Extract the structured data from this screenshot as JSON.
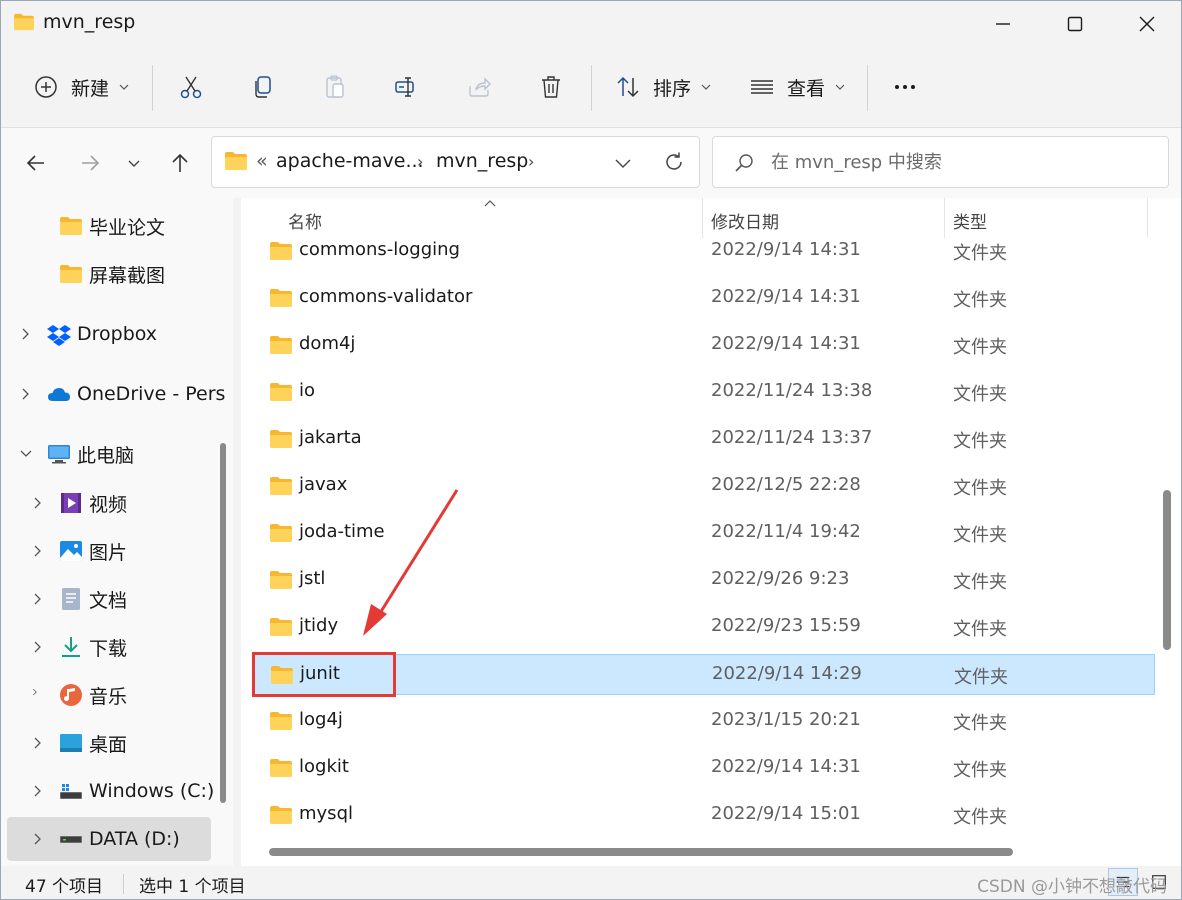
{
  "window": {
    "title": "mvn_resp",
    "minimize_icon": "minimize-icon",
    "maximize_icon": "maximize-icon",
    "close_icon": "close-icon"
  },
  "toolbar": {
    "new_label": "新建",
    "sort_label": "排序",
    "view_label": "查看",
    "icons": [
      "cut-icon",
      "copy-icon",
      "paste-icon",
      "rename-icon",
      "share-icon",
      "delete-icon",
      "more-icon"
    ]
  },
  "address_bar": {
    "overflow": "«",
    "segments": [
      "apache-mave...",
      "mvn_resp"
    ],
    "separator": "›"
  },
  "search": {
    "placeholder": "在 mvn_resp 中搜索"
  },
  "sidebar": {
    "items": [
      {
        "label": "毕业论文",
        "icon": "folder-icon",
        "expandable": false
      },
      {
        "label": "屏幕截图",
        "icon": "folder-icon",
        "expandable": false
      },
      {
        "label": "Dropbox",
        "icon": "dropbox-icon",
        "expandable": true
      },
      {
        "label": "OneDrive - Pers",
        "icon": "onedrive-icon",
        "expandable": true
      },
      {
        "label": "此电脑",
        "icon": "computer-icon",
        "expandable": true,
        "expanded": true
      },
      {
        "label": "视频",
        "icon": "videos-icon",
        "expandable": true
      },
      {
        "label": "图片",
        "icon": "pictures-icon",
        "expandable": true
      },
      {
        "label": "文档",
        "icon": "documents-icon",
        "expandable": true
      },
      {
        "label": "下载",
        "icon": "downloads-icon",
        "expandable": true
      },
      {
        "label": "音乐",
        "icon": "music-icon",
        "expandable": true
      },
      {
        "label": "桌面",
        "icon": "desktop-icon",
        "expandable": true
      },
      {
        "label": "Windows (C:)",
        "icon": "drive-icon",
        "expandable": true
      },
      {
        "label": "DATA (D:)",
        "icon": "drive-icon",
        "expandable": true,
        "selected": true
      }
    ]
  },
  "columns": {
    "name": "名称",
    "date": "修改日期",
    "type": "类型"
  },
  "files": [
    {
      "name": "commons-logging",
      "date": "2022/9/14 14:31",
      "type": "文件夹"
    },
    {
      "name": "commons-validator",
      "date": "2022/9/14 14:31",
      "type": "文件夹"
    },
    {
      "name": "dom4j",
      "date": "2022/9/14 14:31",
      "type": "文件夹"
    },
    {
      "name": "io",
      "date": "2022/11/24 13:38",
      "type": "文件夹"
    },
    {
      "name": "jakarta",
      "date": "2022/11/24 13:37",
      "type": "文件夹"
    },
    {
      "name": "javax",
      "date": "2022/12/5 22:28",
      "type": "文件夹"
    },
    {
      "name": "joda-time",
      "date": "2022/11/4 19:42",
      "type": "文件夹"
    },
    {
      "name": "jstl",
      "date": "2022/9/26 9:23",
      "type": "文件夹"
    },
    {
      "name": "jtidy",
      "date": "2022/9/23 15:59",
      "type": "文件夹"
    },
    {
      "name": "junit",
      "date": "2022/9/14 14:29",
      "type": "文件夹",
      "selected": true
    },
    {
      "name": "log4j",
      "date": "2023/1/15 20:21",
      "type": "文件夹"
    },
    {
      "name": "logkit",
      "date": "2022/9/14 14:31",
      "type": "文件夹"
    },
    {
      "name": "mysql",
      "date": "2022/9/14 15:01",
      "type": "文件夹"
    }
  ],
  "status": {
    "item_count": "47 个项目",
    "selected_count": "选中 1 个项目",
    "watermark": "CSDN @小钟不想敲代码"
  },
  "colors": {
    "selection": "#cce8ff",
    "selection_border": "#99d1ff",
    "annotation": "#e53935",
    "folder": "#ffc83d"
  }
}
